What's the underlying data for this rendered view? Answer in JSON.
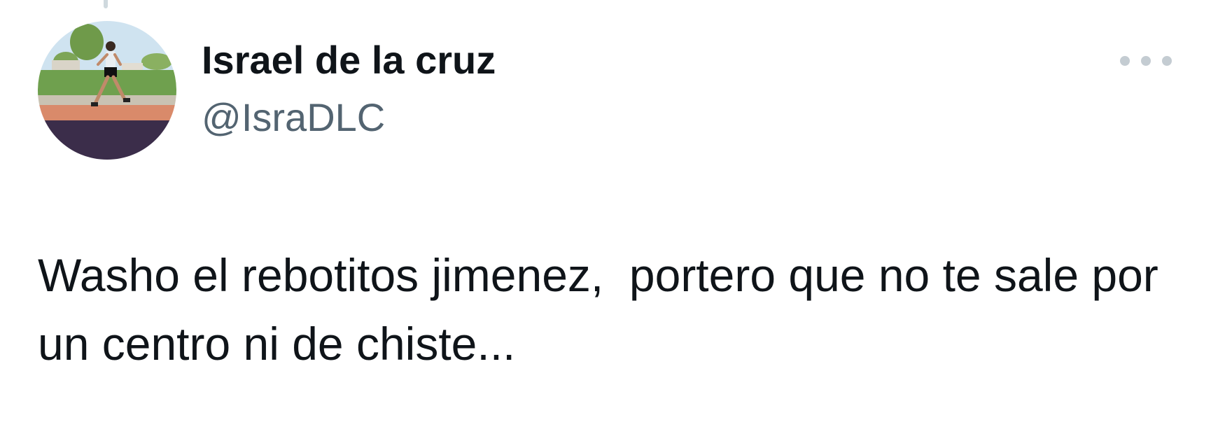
{
  "tweet": {
    "author": {
      "display_name": "Israel de la cruz",
      "handle": "@IsraDLC",
      "avatar_icon": "runner-photo"
    },
    "more_icon": "more-horizontal-icon",
    "text": "Washo el rebotitos jimenez,  portero que no te sale por un centro ni de chiste..."
  },
  "colors": {
    "primary_text": "#0f1419",
    "secondary_text": "#536471",
    "icon_muted": "#c4ccd2",
    "background": "#ffffff"
  }
}
